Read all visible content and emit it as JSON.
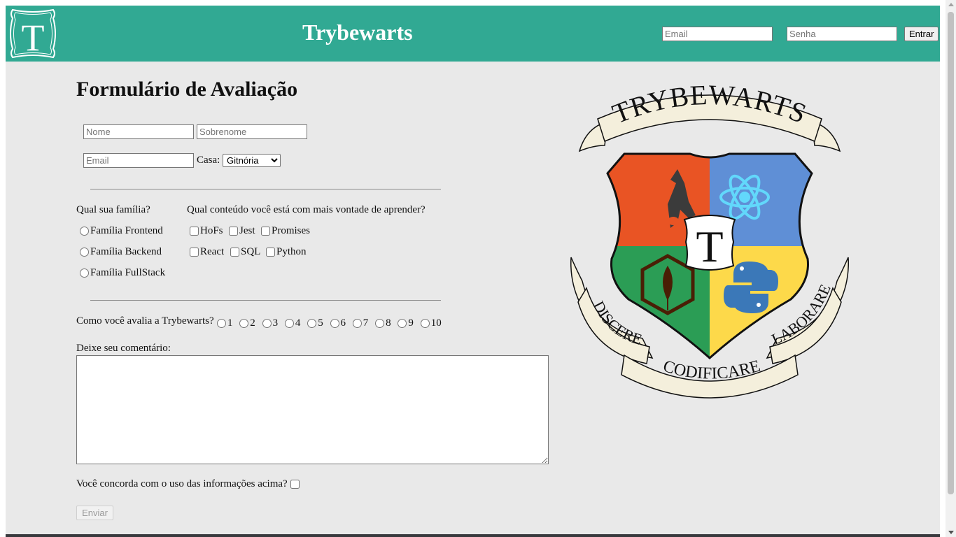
{
  "header": {
    "brand_title": "Trybewarts",
    "logo_letter": "T",
    "login": {
      "email_placeholder": "Email",
      "password_placeholder": "Senha",
      "submit_label": "Entrar"
    }
  },
  "form": {
    "title": "Formulário de Avaliação",
    "name_placeholder": "Nome",
    "lastname_placeholder": "Sobrenome",
    "email_placeholder": "Email",
    "house_label": "Casa:",
    "house_selected": "Gitnória",
    "family": {
      "question": "Qual sua família?",
      "options": [
        "Família Frontend",
        "Família Backend",
        "Família FullStack"
      ]
    },
    "subjects": {
      "question": "Qual conteúdo você está com mais vontade de aprender?",
      "options": [
        "HoFs",
        "Jest",
        "Promises",
        "React",
        "SQL",
        "Python"
      ]
    },
    "rating": {
      "question": "Como você avalia a Trybewarts?",
      "options": [
        "1",
        "2",
        "3",
        "4",
        "5",
        "6",
        "7",
        "8",
        "9",
        "10"
      ]
    },
    "comment_label": "Deixe seu comentário:",
    "agreement_label": "Você concorda com o uso das informações acima?",
    "submit_label": "Enviar"
  },
  "crest": {
    "banner_top": "TRYBEWARTS",
    "center_letter": "T",
    "motto_left": "DISCERE",
    "motto_center": "CODIFICARE",
    "motto_right": "LABORARE"
  },
  "colors": {
    "header_bg": "#31a993",
    "page_bg": "#e9e9e9",
    "crest_orange": "#e95424",
    "crest_blue": "#5f8fd6",
    "crest_green": "#2b9d55",
    "crest_yellow": "#fdd94a",
    "scroll_cream": "#f4efdc"
  }
}
